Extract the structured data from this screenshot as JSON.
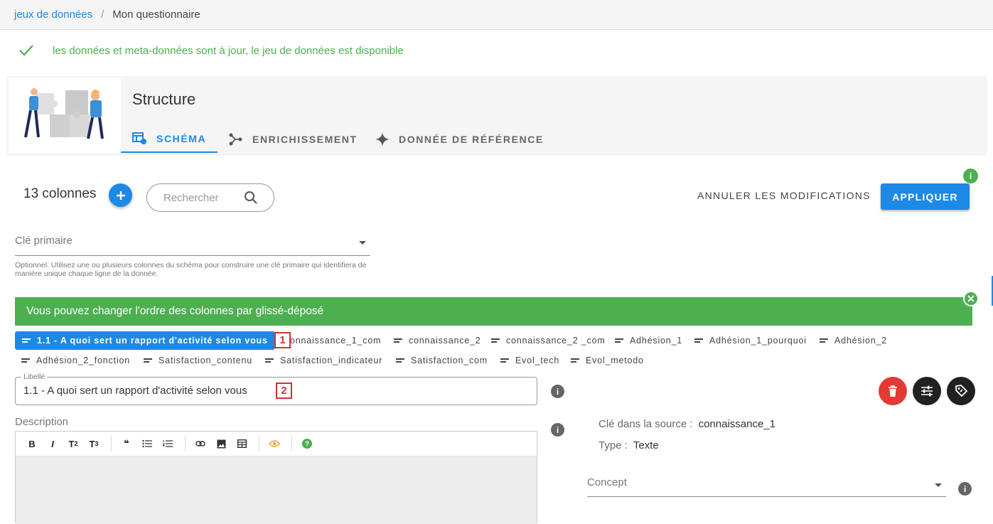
{
  "breadcrumb": {
    "link": "jeux de données",
    "separator": "/",
    "current": "Mon questionnaire"
  },
  "status": {
    "text": "les données et meta-données sont à jour, le jeu de données est disponible",
    "color": "#4caf50"
  },
  "structure": {
    "title": "Structure",
    "tabs": [
      {
        "label": "SCHÉMA",
        "icon": "schema-icon",
        "active": true
      },
      {
        "label": "ENRICHISSEMENT",
        "icon": "share-icon",
        "active": false
      },
      {
        "label": "DONNÉE DE RÉFÉRENCE",
        "icon": "sparkle-icon",
        "active": false
      }
    ]
  },
  "toolbar": {
    "column_count": "13 colonnes",
    "search_placeholder": "Rechercher",
    "cancel_label": "ANNULER LES MODIFICATIONS",
    "apply_label": "APPLIQUER",
    "info_label": "i"
  },
  "primary_key": {
    "label": "Clé primaire",
    "hint": "Optionnel. Utilisez une ou plusieurs colonnes du schéma pour construire une clé primaire qui identifiera de manière unique chaque ligne de la donnée."
  },
  "banner": {
    "text": "Vous pouvez changer l'ordre des colonnes par glissé-déposé"
  },
  "columns": [
    "1.1 - A quoi sert un rapport d'activité selon vous",
    "connaissance_1_com",
    "connaissance_2",
    "connaissance_2 _com",
    "Adhésion_1",
    "Adhésion_1_pourquoi",
    "Adhésion_2",
    "Adhésion_2_fonction",
    "Satisfaction_contenu",
    "Satisfaction_indicateur",
    "Satisfaction_com",
    "Evol_tech",
    "Evol_metodo"
  ],
  "badges": [
    "1",
    "2"
  ],
  "field": {
    "libelle_label": "Libellé",
    "libelle_value": "1.1 - A quoi sert un rapport d'activité selon vous",
    "description_label": "Description",
    "source_key_label": "Clé dans la source :",
    "source_key_value": "connaissance_1",
    "type_label": "Type :",
    "type_value": "Texte",
    "concept_label": "Concept"
  },
  "colors": {
    "primary": "#1e88e5",
    "success": "#4caf50",
    "danger": "#e53935",
    "dark": "#212121"
  }
}
